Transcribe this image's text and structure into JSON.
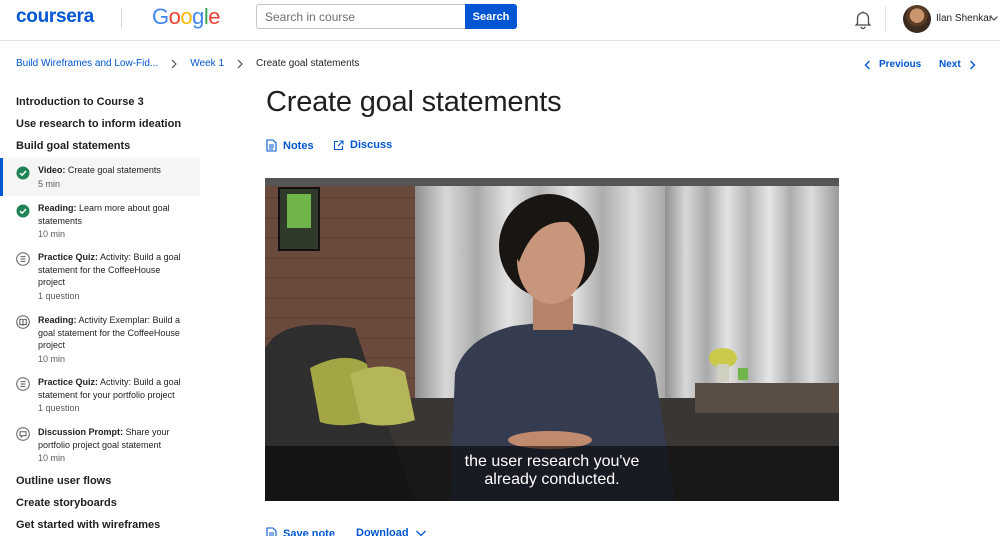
{
  "header": {
    "brand": "coursera",
    "partner": [
      "G",
      "o",
      "o",
      "g",
      "l",
      "e"
    ],
    "partner_colors": [
      "#4285F4",
      "#EA4335",
      "#FBBC05",
      "#4285F4",
      "#34A853",
      "#EA4335"
    ],
    "search_placeholder": "Search in course",
    "search_button": "Search",
    "user_name": "Ilan Shenkar"
  },
  "breadcrumb": {
    "course": "Build Wireframes and Low-Fid...",
    "week": "Week 1",
    "current": "Create goal statements"
  },
  "nav": {
    "previous": "Previous",
    "next": "Next"
  },
  "sidebar": {
    "sections_top": [
      "Introduction to Course 3",
      "Use research to inform ideation",
      "Build goal statements"
    ],
    "items": [
      {
        "type": "Video:",
        "title": "Create goal statements",
        "meta": "5 min",
        "status": "completed",
        "icon": "check-circle-icon"
      },
      {
        "type": "Reading:",
        "title": "Learn more about goal statements",
        "meta": "10 min",
        "status": "completed",
        "icon": "check-circle-icon"
      },
      {
        "type": "Practice Quiz:",
        "title": "Activity: Build a goal statement for the CoffeeHouse project",
        "meta": "1 question",
        "status": "todo",
        "icon": "quiz-icon"
      },
      {
        "type": "Reading:",
        "title": "Activity Exemplar: Build a goal statement for the CoffeeHouse project",
        "meta": "10 min",
        "status": "todo",
        "icon": "reading-icon"
      },
      {
        "type": "Practice Quiz:",
        "title": "Activity: Build a goal statement for your portfolio project",
        "meta": "1 question",
        "status": "todo",
        "icon": "quiz-icon"
      },
      {
        "type": "Discussion Prompt:",
        "title": "Share your portfolio project goal statement",
        "meta": "10 min",
        "status": "todo",
        "icon": "discussion-icon"
      }
    ],
    "sections_bottom": [
      "Outline user flows",
      "Create storyboards",
      "Get started with wireframes"
    ]
  },
  "main": {
    "title": "Create goal statements",
    "notes_label": "Notes",
    "discuss_label": "Discuss",
    "caption_line1": "the user research you've",
    "caption_line2": "already conducted.",
    "save_note_label": "Save note",
    "download_label": "Download"
  },
  "colors": {
    "accent": "#0056d2",
    "success": "#1f8354",
    "text": "#1f1f1f"
  }
}
